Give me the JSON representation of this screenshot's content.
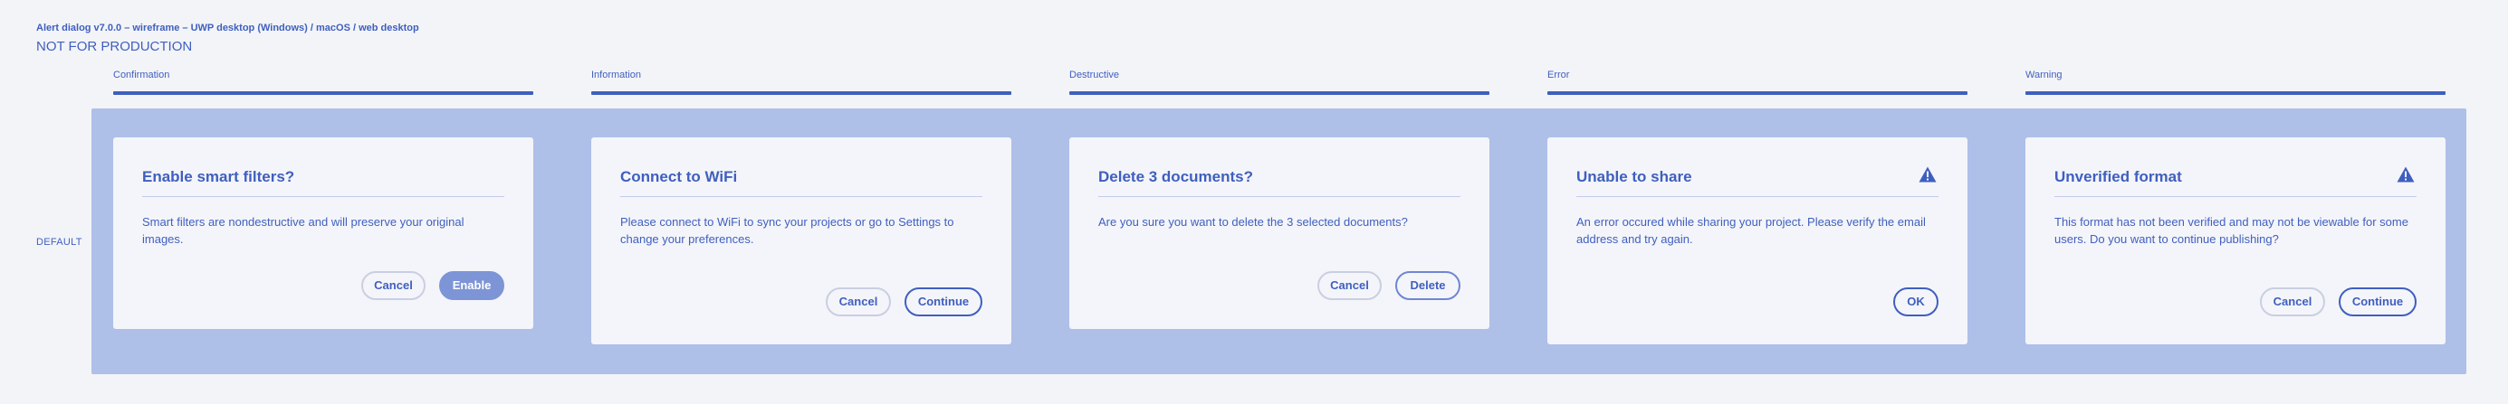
{
  "header": {
    "title": "Alert dialog v7.0.0 – wireframe – UWP desktop (Windows) / macOS / web desktop",
    "subtitle": "NOT FOR PRODUCTION"
  },
  "row_label": "DEFAULT",
  "columns": [
    {
      "label": "Confirmation"
    },
    {
      "label": "Information"
    },
    {
      "label": "Destructive"
    },
    {
      "label": "Error"
    },
    {
      "label": "Warning"
    }
  ],
  "dialogs": [
    {
      "title": "Enable smart filters?",
      "body": "Smart filters are nondestructive and will preserve your original images.",
      "buttons": [
        "Cancel",
        "Enable"
      ]
    },
    {
      "title": "Connect to WiFi",
      "body": "Please connect to WiFi to sync your projects or go to Settings to change your preferences.",
      "buttons": [
        "Cancel",
        "Continue"
      ]
    },
    {
      "title": "Delete 3 documents?",
      "body": "Are you sure you want to delete the 3 selected documents?",
      "buttons": [
        "Cancel",
        "Delete"
      ]
    },
    {
      "title": "Unable to share",
      "body": "An error occured while sharing your project. Please verify the email address and try again.",
      "buttons": [
        "OK"
      ],
      "icon": "alert-triangle-icon"
    },
    {
      "title": "Unverified format",
      "body": "This format has not been verified and may not be viewable for some users. Do you want to continue publishing?",
      "buttons": [
        "Cancel",
        "Continue"
      ],
      "icon": "alert-triangle-icon"
    }
  ],
  "colors": {
    "accent": "#3f5fbf",
    "stage": "#aebfe8",
    "cta": "#7d95d6",
    "background": "#f3f4f8"
  }
}
